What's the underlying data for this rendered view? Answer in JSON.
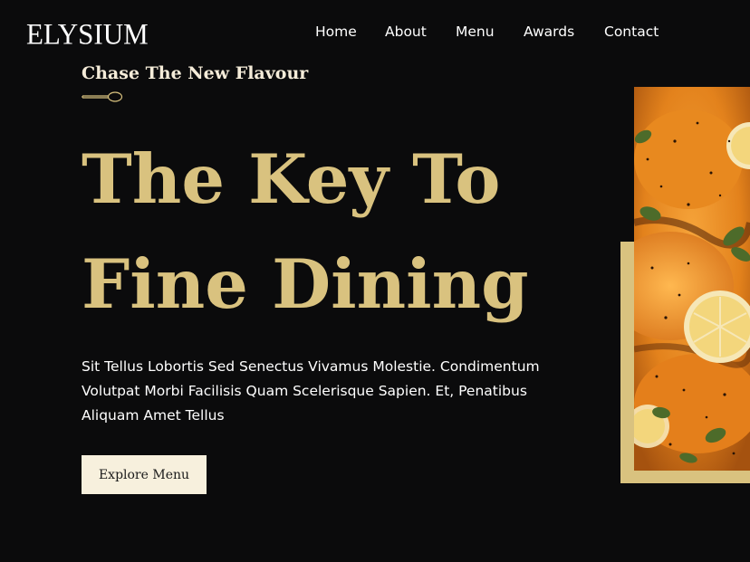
{
  "brand": {
    "logo_text": "ELYSIUM"
  },
  "nav": {
    "items": [
      "Home",
      "About",
      "Menu",
      "Awards",
      "Contact"
    ]
  },
  "hero": {
    "tagline": "Chase The New Flavour",
    "headline_line1": "The Key To",
    "headline_line2": "Fine Dining",
    "description": "Sit Tellus Lobortis Sed Senectus Vivamus Molestie. Condimentum Volutpat Morbi Facilisis Quam Scelerisque Sapien. Et, Penatibus Aliquam Amet Tellus",
    "cta_label": "Explore Menu"
  },
  "colors": {
    "background": "#0b0b0c",
    "accent_gold": "#d9c27f",
    "cream": "#f7f0dd",
    "text": "#ffffff"
  },
  "icons": {
    "divider": "spoon-icon"
  }
}
